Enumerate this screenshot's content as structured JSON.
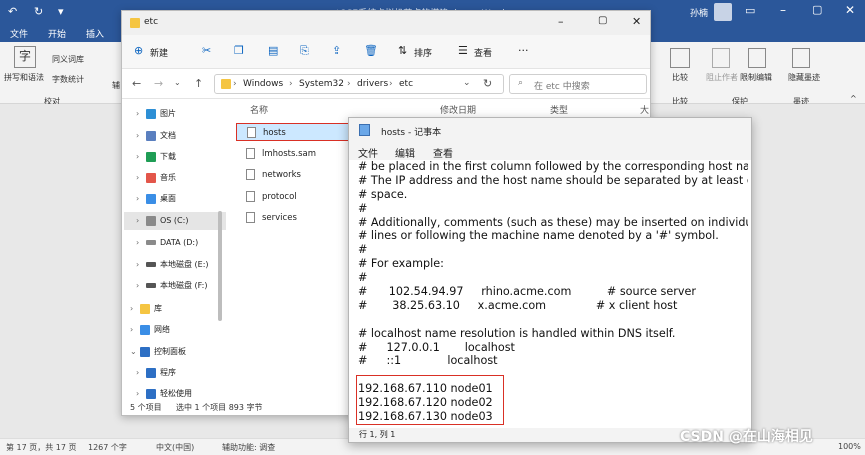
{
  "word": {
    "title": "centOS7系统虚拟机节点的搭建.docx - Word",
    "user": "孙楠",
    "tabs": [
      "文件",
      "开始",
      "插入"
    ],
    "ribbon_left": {
      "spell": "拼写和语法",
      "thesaurus": "同义词库",
      "wordcount": "字数统计",
      "group": "校对",
      "partial": "辅"
    },
    "ribbon_right": {
      "compare": "比较",
      "compare_group": "比较",
      "block": "阻止作者",
      "restrict": "限制编辑",
      "protect_group": "保护",
      "hide_ink": "隐藏墨迹",
      "ink_group": "墨迹"
    },
    "status": {
      "page": "第 17 页，共 17 页",
      "words": "1267 个字",
      "lang": "中文(中国)",
      "access": "辅助功能: 调查",
      "zoom": "100%"
    }
  },
  "explorer": {
    "title": "etc",
    "toolbar": {
      "new": "新建",
      "sort": "排序",
      "view": "查看"
    },
    "breadcrumb": [
      "Windows",
      "System32",
      "drivers",
      "etc"
    ],
    "search_placeholder": "在 etc 中搜索",
    "columns": {
      "name": "名称",
      "modified": "修改日期",
      "type": "类型",
      "size": "大小"
    },
    "nav": [
      "图片",
      "文档",
      "下载",
      "音乐",
      "桌面",
      "OS (C:)",
      "DATA (D:)",
      "本地磁盘 (E:)",
      "本地磁盘 (F:)",
      "库",
      "网络",
      "控制面板",
      "程序",
      "轻松使用"
    ],
    "files": [
      "hosts",
      "lmhosts.sam",
      "networks",
      "protocol",
      "services"
    ],
    "status": {
      "count": "5 个项目",
      "selected": "选中 1 个项目  893 字节"
    }
  },
  "notepad": {
    "title": "hosts - 记事本",
    "menu": [
      "文件",
      "编辑",
      "查看"
    ],
    "lines": [
      "# be placed in the first column followed by the corresponding host name.",
      "# The IP address and the host name should be separated by at least one",
      "# space.",
      "#",
      "# Additionally, comments (such as these) may be inserted on individual",
      "# lines or following the machine name denoted by a '#' symbol.",
      "#",
      "# For example:",
      "#",
      "#      102.54.94.97     rhino.acme.com          # source server",
      "#       38.25.63.10     x.acme.com              # x client host",
      "",
      "# localhost name resolution is handled within DNS itself.",
      "#\t127.0.0.1       localhost",
      "#\t::1             localhost",
      "",
      "192.168.67.110 node01",
      "192.168.67.120 node02",
      "192.168.67.130 node03"
    ],
    "status": "行 1, 列 1"
  },
  "watermark": "CSDN @在山海相见",
  "colors": {
    "word_blue": "#2b579a",
    "highlight": "#cce8ff",
    "red_box": "#d93025",
    "folder": "#f5c542"
  }
}
